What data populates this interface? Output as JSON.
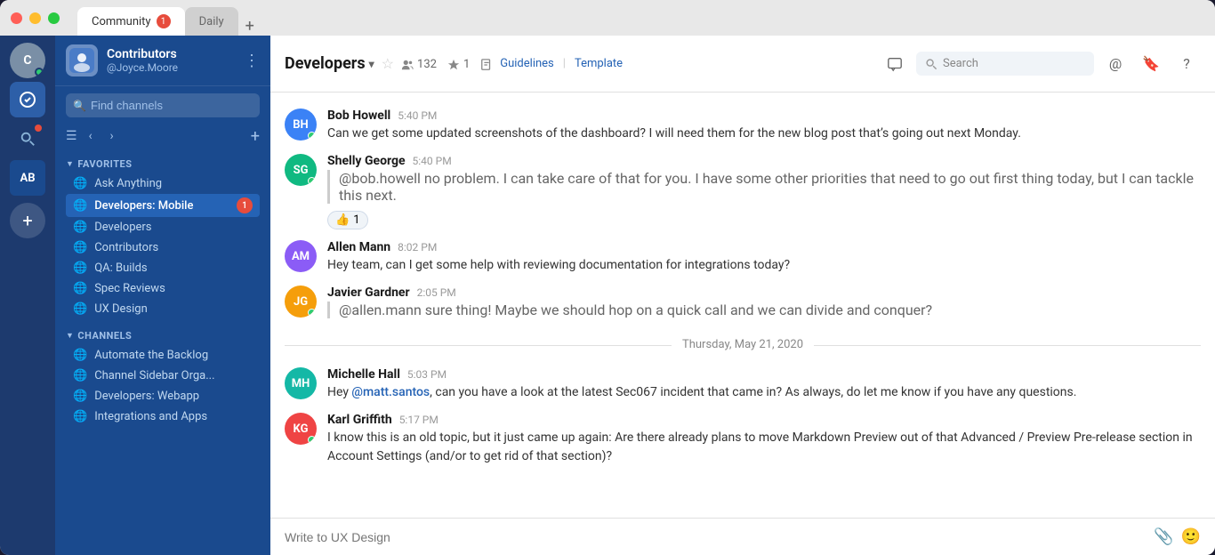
{
  "window": {
    "tabs": [
      {
        "label": "Community",
        "badge": "1",
        "active": true
      },
      {
        "label": "Daily",
        "badge": null,
        "active": false
      }
    ],
    "tab_add": "+"
  },
  "workspace": {
    "name": "Contributors",
    "user": "@Joyce.Moore",
    "avatar_initials": "C"
  },
  "sidebar": {
    "search_placeholder": "Find channels",
    "find_channels": "Find channels",
    "add_label": "+",
    "favorites_section": "FAVORITES",
    "channels_section": "CHANNELS",
    "favorites": [
      {
        "label": "Ask Anything",
        "icon": "🌐",
        "active": false,
        "badge": null
      },
      {
        "label": "Developers: Mobile",
        "icon": "🌐",
        "active": true,
        "badge": "1"
      },
      {
        "label": "Developers",
        "icon": "🌐",
        "active": false,
        "badge": null
      },
      {
        "label": "Contributors",
        "icon": "🌐",
        "active": false,
        "badge": null
      },
      {
        "label": "QA: Builds",
        "icon": "🌐",
        "active": false,
        "badge": null
      },
      {
        "label": "Spec Reviews",
        "icon": "🌐",
        "active": false,
        "badge": null
      },
      {
        "label": "UX Design",
        "icon": "🌐",
        "active": false,
        "badge": null
      }
    ],
    "channels": [
      {
        "label": "Automate the Backlog",
        "icon": "🌐",
        "active": false,
        "badge": null
      },
      {
        "label": "Channel Sidebar Orga...",
        "icon": "🌐",
        "active": false,
        "badge": null
      },
      {
        "label": "Developers: Webapp",
        "icon": "🌐",
        "active": false,
        "badge": null
      },
      {
        "label": "Integrations and Apps",
        "icon": "🌐",
        "active": false,
        "badge": null
      }
    ]
  },
  "channel": {
    "name": "Developers",
    "member_count": "132",
    "star_count": "1",
    "guidelines": "Guidelines",
    "template": "Template",
    "search_placeholder": "Search"
  },
  "messages": [
    {
      "id": "msg1",
      "name": "Bob Howell",
      "time": "5:40 PM",
      "avatar_color": "av-blue",
      "avatar_initials": "BH",
      "online": true,
      "text": "Can we get some updated screenshots of the dashboard? I will need them for the new blog post that’s going out next Monday.",
      "quote": null,
      "mention": null,
      "reaction": null
    },
    {
      "id": "msg2",
      "name": "Shelly George",
      "time": "5:40 PM",
      "avatar_color": "av-green",
      "avatar_initials": "SG",
      "online": true,
      "quote": "@bob.howell no problem. I can take care of that for you. I have some other priorities that need to go out first thing today, but I can tackle this next.",
      "mention": "@bob.howell",
      "text": "no problem. I can take care of that for you. I have some other priorities that need to go out first thing today, but I can tackle this next.",
      "reaction": "👍 1"
    },
    {
      "id": "msg3",
      "name": "Allen Mann",
      "time": "8:02 PM",
      "avatar_color": "av-purple",
      "avatar_initials": "AM",
      "online": false,
      "text": "Hey team, can I get some help with reviewing documentation for integrations today?",
      "quote": null,
      "mention": null,
      "reaction": null
    },
    {
      "id": "msg4",
      "name": "Javier Gardner",
      "time": "2:05 PM",
      "avatar_color": "av-orange",
      "avatar_initials": "JG",
      "online": true,
      "quote": "@allen.mann sure thing! Maybe we should hop on a quick call and we can divide and conquer?",
      "mention": "@allen.mann",
      "text": "sure thing! Maybe we should hop on a quick call and we can divide and conquer?",
      "reaction": null
    }
  ],
  "date_divider": "Thursday, May 21, 2020",
  "messages2": [
    {
      "id": "msg5",
      "name": "Michelle Hall",
      "time": "5:03 PM",
      "avatar_color": "av-teal",
      "avatar_initials": "MH",
      "online": false,
      "mention_text": "@matt.santos",
      "text": ", can you have a look at the latest Sec067 incident that came in? As always, do let me know if you have any questions.",
      "reaction": null
    },
    {
      "id": "msg6",
      "name": "Karl Griffith",
      "time": "5:17 PM",
      "avatar_color": "av-red",
      "avatar_initials": "KG",
      "online": true,
      "text": "I know this is an old topic, but it just came up again: Are there already plans to move Markdown Preview out of that Advanced / Preview Pre-release section in Account Settings (and/or to get rid of that section)?",
      "reaction": null
    }
  ],
  "message_input": {
    "placeholder": "Write to UX Design"
  },
  "icons": {
    "mention": "@",
    "bookmark": "🔖",
    "help": "?",
    "attachment": "📎",
    "emoji": "🙂"
  }
}
